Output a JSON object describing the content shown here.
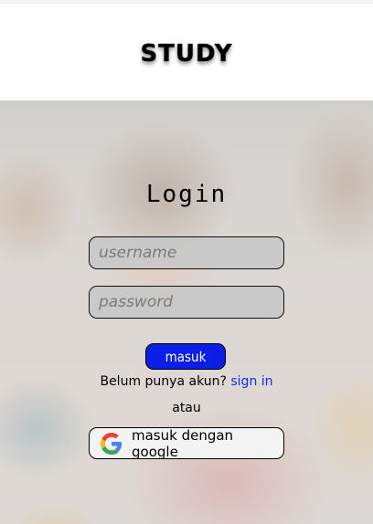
{
  "header": {
    "logo_text": "STUDY"
  },
  "login": {
    "title": "Login",
    "username_placeholder": "username",
    "password_placeholder": "password",
    "submit_label": "masuk",
    "no_account_text": "Belum punya akun?",
    "signup_link": "sign in",
    "or_text": "atau",
    "google_label": "masuk dengan google",
    "google_icon": "google-icon"
  },
  "colors": {
    "primary_button": "#0b1ee8",
    "link": "#0b2ff0",
    "header_bg": "#ffffff"
  }
}
